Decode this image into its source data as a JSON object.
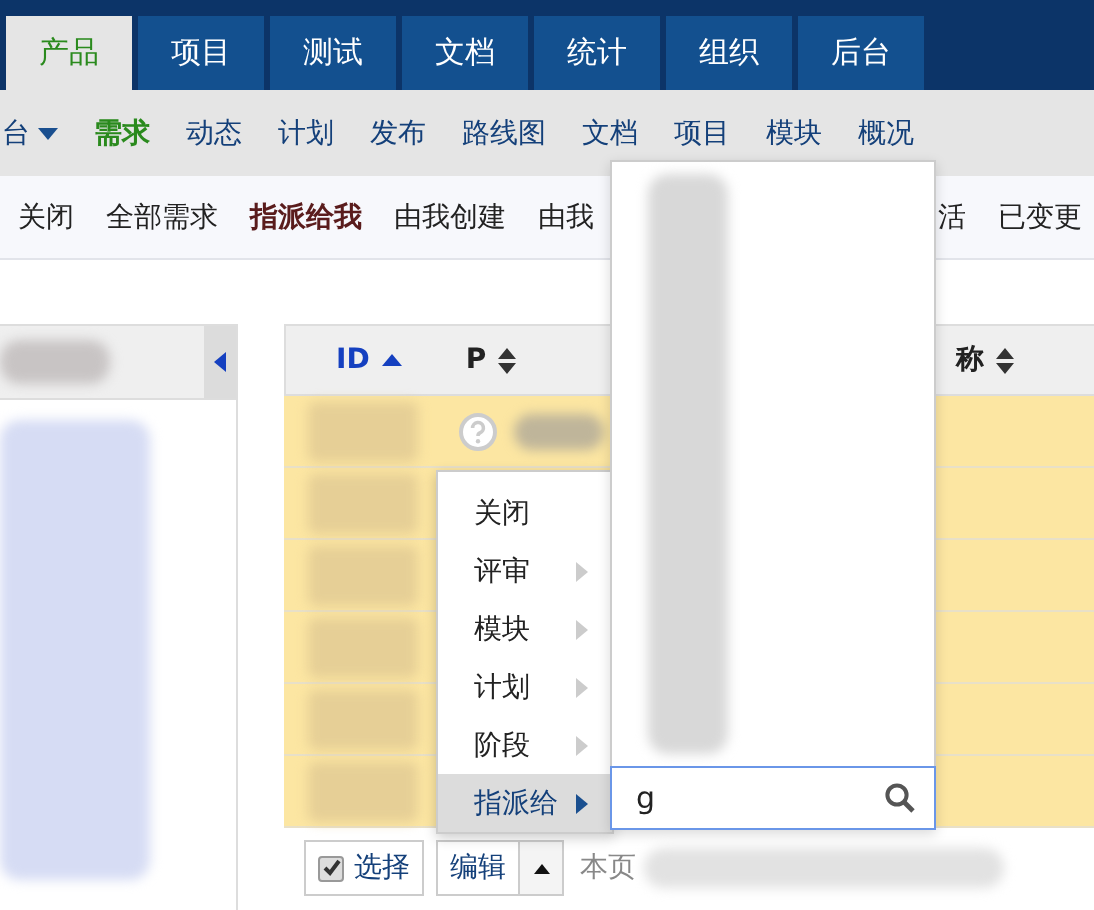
{
  "top_tabs": [
    {
      "label": "产品",
      "selected": true
    },
    {
      "label": "项目",
      "selected": false
    },
    {
      "label": "测试",
      "selected": false
    },
    {
      "label": "文档",
      "selected": false
    },
    {
      "label": "统计",
      "selected": false
    },
    {
      "label": "组织",
      "selected": false
    },
    {
      "label": "后台",
      "selected": false
    }
  ],
  "sub_nav": [
    {
      "label": "台",
      "kind": "dropdown",
      "selected": false
    },
    {
      "label": "需求",
      "kind": "link",
      "selected": true
    },
    {
      "label": "动态",
      "kind": "link",
      "selected": false
    },
    {
      "label": "计划",
      "kind": "link",
      "selected": false
    },
    {
      "label": "发布",
      "kind": "link",
      "selected": false
    },
    {
      "label": "路线图",
      "kind": "link",
      "selected": false
    },
    {
      "label": "文档",
      "kind": "link",
      "selected": false
    },
    {
      "label": "项目",
      "kind": "link",
      "selected": false
    },
    {
      "label": "模块",
      "kind": "link",
      "selected": false
    },
    {
      "label": "概况",
      "kind": "link",
      "selected": false
    }
  ],
  "filters": [
    {
      "label": "关闭",
      "selected": false
    },
    {
      "label": "全部需求",
      "selected": false
    },
    {
      "label": "指派给我",
      "selected": true
    },
    {
      "label": "由我创建",
      "selected": false
    },
    {
      "label": "由我",
      "selected": false
    }
  ],
  "filters_right": [
    {
      "label": "活",
      "selected": false
    },
    {
      "label": "已变更",
      "selected": false
    }
  ],
  "table": {
    "columns": [
      {
        "label": "ID",
        "sorted": true
      },
      {
        "label": "P",
        "sorted": false
      },
      {
        "label": "称",
        "sorted": false
      }
    ]
  },
  "context_menu": {
    "items": [
      {
        "label": "关闭",
        "submenu": false,
        "selected": false
      },
      {
        "label": "评审",
        "submenu": true,
        "selected": false
      },
      {
        "label": "模块",
        "submenu": true,
        "selected": false
      },
      {
        "label": "计划",
        "submenu": true,
        "selected": false
      },
      {
        "label": "阶段",
        "submenu": true,
        "selected": false
      },
      {
        "label": "指派给",
        "submenu": true,
        "selected": true
      }
    ]
  },
  "assign_dropdown": {
    "search": {
      "value": "g"
    }
  },
  "bottom_bar": {
    "select_button": {
      "label": "选择",
      "checked": true
    },
    "edit_button": {
      "label": "编辑"
    },
    "page_text": "本页"
  }
}
